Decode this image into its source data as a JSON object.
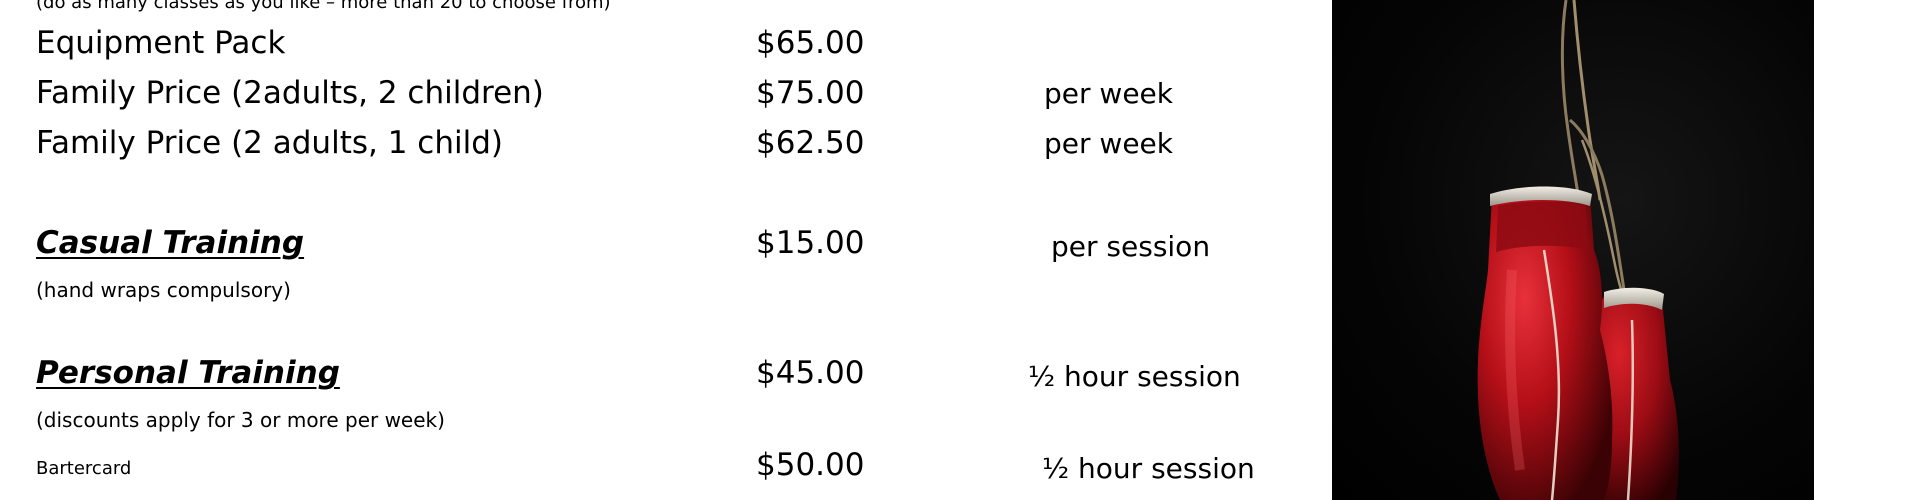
{
  "top_note": "(do as many classes as you like – more than 20 to choose from)",
  "rows": [
    {
      "item": "Equipment Pack",
      "price": "$65.00",
      "unit": ""
    },
    {
      "item": "Family Price (2adults, 2 children)",
      "price": "$75.00",
      "unit": "per week"
    },
    {
      "item": "Family Price (2 adults, 1 child)",
      "price": "$62.50",
      "unit": "per week"
    }
  ],
  "casual": {
    "heading": "Casual Training",
    "price": "$15.00",
    "unit": "per session",
    "note": "(hand wraps compulsory)"
  },
  "personal": {
    "heading": "Personal Training",
    "price": "$45.00",
    "unit": "½ hour session",
    "note": "(discounts apply for 3 or more per week)"
  },
  "bartercard": {
    "label": "Bartercard",
    "price": "$50.00",
    "unit": "½ hour session"
  },
  "image": {
    "subject": "red-boxing-gloves-hanging",
    "background_color": "#000000",
    "glove_color": "#c4121a"
  }
}
